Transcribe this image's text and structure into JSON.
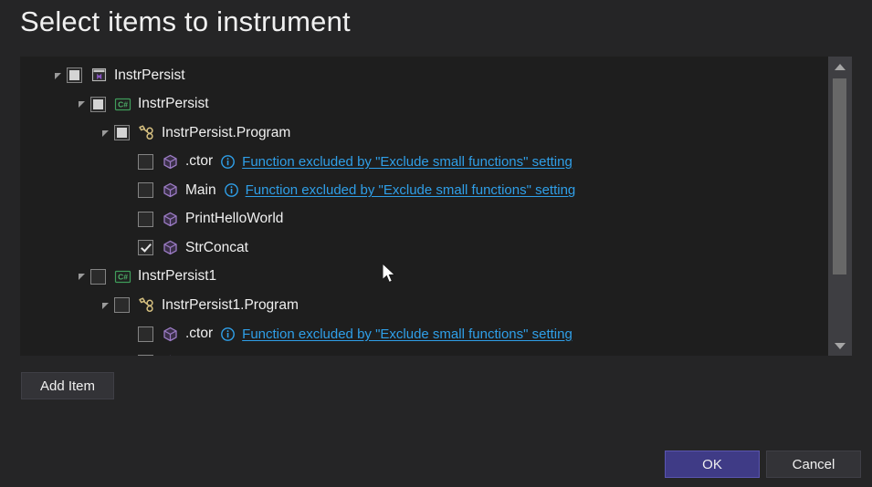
{
  "dialog": {
    "title": "Select items to instrument"
  },
  "tree": {
    "rows": [
      {
        "label": "InstrPersist",
        "depth": 0,
        "icon": "visual-studio-solution-icon",
        "checkbox": "indeterminate",
        "expander": "expanded",
        "info": false,
        "link": ""
      },
      {
        "label": "InstrPersist",
        "depth": 1,
        "icon": "csharp-project-icon",
        "checkbox": "indeterminate",
        "expander": "expanded",
        "info": false,
        "link": ""
      },
      {
        "label": "InstrPersist.Program",
        "depth": 2,
        "icon": "class-icon",
        "checkbox": "indeterminate",
        "expander": "expanded",
        "info": false,
        "link": ""
      },
      {
        "label": ".ctor",
        "depth": 3,
        "icon": "method-cube-icon",
        "checkbox": "unchecked",
        "expander": "none",
        "info": true,
        "link": "Function excluded by \"Exclude small functions\" setting"
      },
      {
        "label": "Main",
        "depth": 3,
        "icon": "method-cube-icon",
        "checkbox": "unchecked",
        "expander": "none",
        "info": true,
        "link": "Function excluded by \"Exclude small functions\" setting"
      },
      {
        "label": "PrintHelloWorld",
        "depth": 3,
        "icon": "method-cube-icon",
        "checkbox": "unchecked",
        "expander": "none",
        "info": false,
        "link": ""
      },
      {
        "label": "StrConcat",
        "depth": 3,
        "icon": "method-cube-icon",
        "checkbox": "checked",
        "expander": "none",
        "info": false,
        "link": ""
      },
      {
        "label": "InstrPersist1",
        "depth": 1,
        "icon": "csharp-project-icon",
        "checkbox": "unchecked",
        "expander": "expanded",
        "info": false,
        "link": ""
      },
      {
        "label": "InstrPersist1.Program",
        "depth": 2,
        "icon": "class-icon",
        "checkbox": "unchecked",
        "expander": "expanded",
        "info": false,
        "link": ""
      },
      {
        "label": ".ctor",
        "depth": 3,
        "icon": "method-cube-icon",
        "checkbox": "unchecked",
        "expander": "none",
        "info": true,
        "link": "Function excluded by \"Exclude small functions\" setting"
      },
      {
        "label": "",
        "depth": 3,
        "icon": "method-cube-icon",
        "checkbox": "unchecked",
        "expander": "none",
        "info": true,
        "link": ""
      }
    ]
  },
  "scrollbar": {
    "up_arrow": "scroll-up-arrow",
    "down_arrow": "scroll-down-arrow"
  },
  "buttons": {
    "add_item": "Add Item",
    "ok": "OK",
    "cancel": "Cancel"
  },
  "colors": {
    "dialog_background": "#252526",
    "tree_background": "#1e1e1e",
    "link": "#2f9fe8",
    "ok_accent": "#3f3b86",
    "csharp_green": "#3f9c5a",
    "class_icon_gold": "#d6c080",
    "method_purple": "#9b7bc4",
    "vs_purple": "#8a56c4"
  }
}
